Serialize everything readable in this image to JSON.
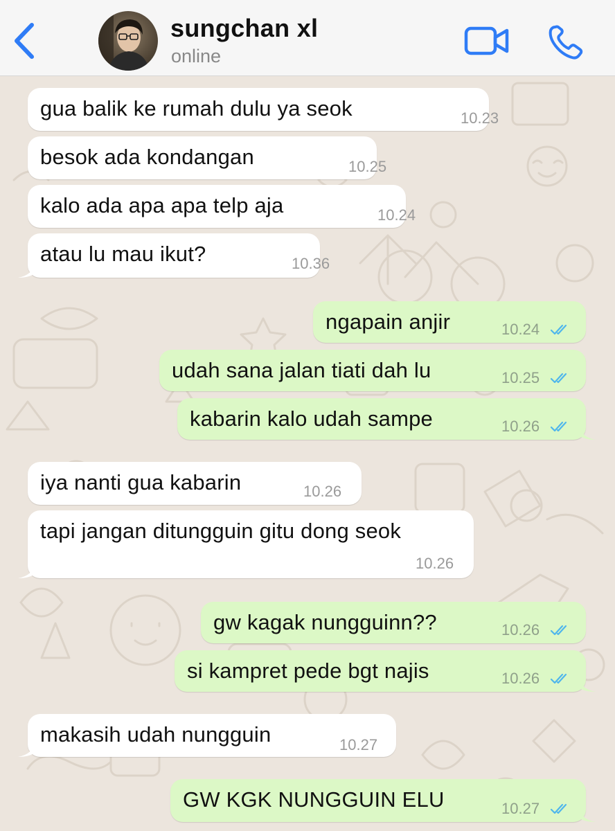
{
  "header": {
    "contact_name": "sungchan xl",
    "status": "online",
    "back_icon": "chevron-left-icon",
    "video_icon": "video-camera-icon",
    "call_icon": "phone-icon",
    "accent_color": "#2f7cf6"
  },
  "messages": [
    {
      "direction": "incoming",
      "text": "gua balik ke rumah dulu ya seok",
      "time": "10.23"
    },
    {
      "direction": "incoming",
      "text": "besok ada kondangan",
      "time": "10.25"
    },
    {
      "direction": "incoming",
      "text": "kalo ada apa apa telp aja",
      "time": "10.24"
    },
    {
      "direction": "incoming",
      "text": "atau lu mau ikut?",
      "time": "10.36"
    },
    {
      "direction": "outgoing",
      "text": "ngapain anjir",
      "time": "10.24",
      "status": "read"
    },
    {
      "direction": "outgoing",
      "text": "udah sana jalan tiati dah lu",
      "time": "10.25",
      "status": "read"
    },
    {
      "direction": "outgoing",
      "text": "kabarin kalo udah sampe",
      "time": "10.26",
      "status": "read"
    },
    {
      "direction": "incoming",
      "text": "iya nanti gua kabarin",
      "time": "10.26"
    },
    {
      "direction": "incoming",
      "text": "tapi jangan ditungguin gitu dong seok",
      "time": "10.26"
    },
    {
      "direction": "outgoing",
      "text": "gw kagak nungguinn??",
      "time": "10.26",
      "status": "read"
    },
    {
      "direction": "outgoing",
      "text": "si kampret pede bgt najis",
      "time": "10.26",
      "status": "read"
    },
    {
      "direction": "incoming",
      "text": "makasih udah nungguin",
      "time": "10.27"
    },
    {
      "direction": "outgoing",
      "text": "GW KGK NUNGGUIN ELU",
      "time": "10.27",
      "status": "read"
    }
  ],
  "colors": {
    "incoming_bubble": "#ffffff",
    "outgoing_bubble": "#dcf8c6",
    "read_ticks": "#4fb6ec",
    "wallpaper": "#ece5dd"
  }
}
